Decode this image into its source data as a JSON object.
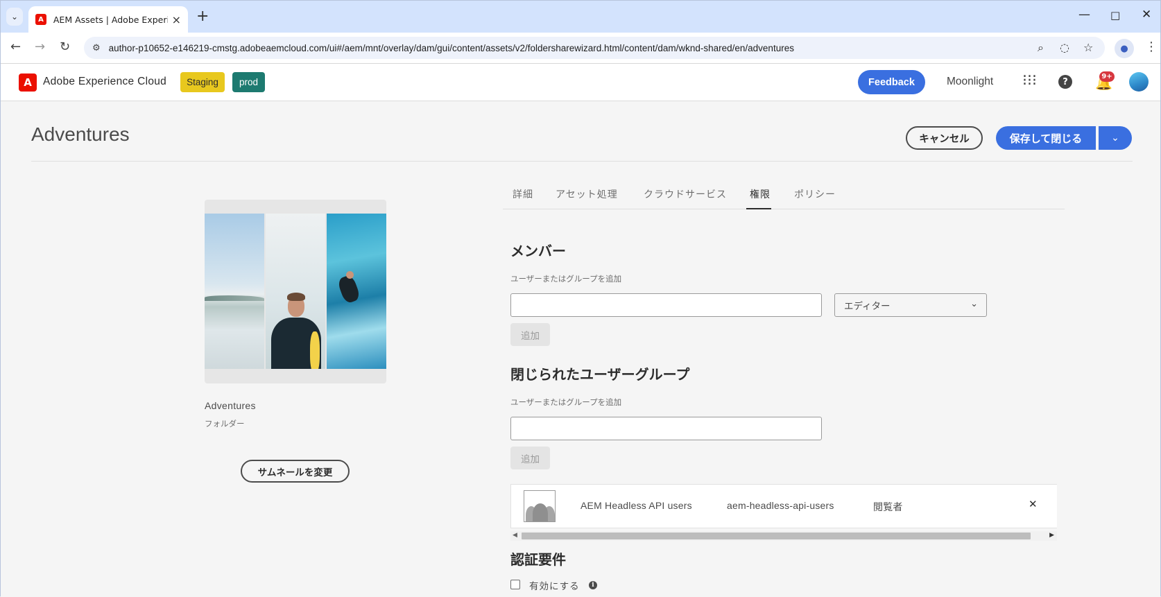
{
  "browser": {
    "tab_title": "AEM Assets | Adobe Experience",
    "tab_menu_icon": "chevron-down-icon",
    "url": "author-p10652-e146219-cmstg.adobeaemcloud.com/ui#/aem/mnt/overlay/dam/gui/content/assets/v2/foldersharewizard.html/content/dam/wknd-shared/en/adventures"
  },
  "header": {
    "brand": "Adobe Experience Cloud",
    "env_staging": "Staging",
    "env_prod": "prod",
    "feedback_label": "Feedback",
    "org_name": "Moonlight",
    "notification_count": "9+"
  },
  "page": {
    "title": "Adventures",
    "cancel_label": "キャンセル",
    "save_close_label": "保存して閉じる"
  },
  "folder": {
    "name": "Adventures",
    "type": "フォルダー",
    "change_thumbnail_label": "サムネールを変更"
  },
  "tabs": [
    {
      "label": "詳細"
    },
    {
      "label": "アセット処理"
    },
    {
      "label": "クラウドサービス"
    },
    {
      "label": "権限"
    },
    {
      "label": "ポリシー"
    }
  ],
  "active_tab": "権限",
  "members": {
    "heading": "メンバー",
    "field_label": "ユーザーまたはグループを追加",
    "input_value": "",
    "role_value": "エディター",
    "add_label": "追加"
  },
  "cug": {
    "heading": "閉じられたユーザーグループ",
    "field_label": "ユーザーまたはグループを追加",
    "input_value": "",
    "add_label": "追加",
    "entries": [
      {
        "display_name": "AEM Headless API users",
        "id": "aem-headless-api-users",
        "role": "閲覧者"
      }
    ]
  },
  "auth": {
    "heading": "認証要件",
    "enable_label": "有効にする",
    "enabled": false
  },
  "colors": {
    "accent": "#3a6fe0",
    "staging": "#e8c81e",
    "prod": "#1d7a70",
    "adobe_red": "#eb1000"
  }
}
